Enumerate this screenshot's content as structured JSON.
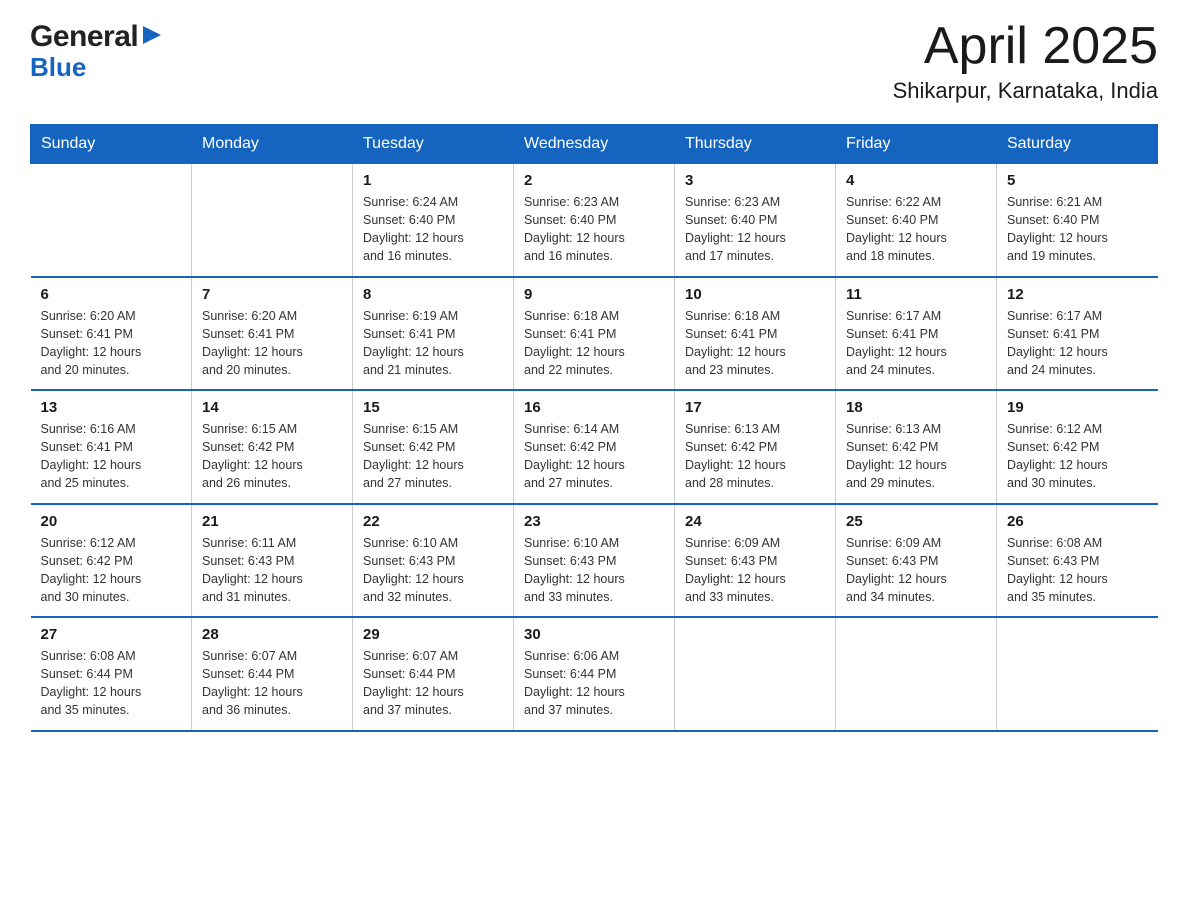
{
  "header": {
    "logo": {
      "general": "General",
      "blue": "Blue",
      "arrow_symbol": "▶"
    },
    "title": "April 2025",
    "location": "Shikarpur, Karnataka, India"
  },
  "calendar": {
    "days_of_week": [
      "Sunday",
      "Monday",
      "Tuesday",
      "Wednesday",
      "Thursday",
      "Friday",
      "Saturday"
    ],
    "weeks": [
      [
        {
          "day": "",
          "info": ""
        },
        {
          "day": "",
          "info": ""
        },
        {
          "day": "1",
          "info": "Sunrise: 6:24 AM\nSunset: 6:40 PM\nDaylight: 12 hours\nand 16 minutes."
        },
        {
          "day": "2",
          "info": "Sunrise: 6:23 AM\nSunset: 6:40 PM\nDaylight: 12 hours\nand 16 minutes."
        },
        {
          "day": "3",
          "info": "Sunrise: 6:23 AM\nSunset: 6:40 PM\nDaylight: 12 hours\nand 17 minutes."
        },
        {
          "day": "4",
          "info": "Sunrise: 6:22 AM\nSunset: 6:40 PM\nDaylight: 12 hours\nand 18 minutes."
        },
        {
          "day": "5",
          "info": "Sunrise: 6:21 AM\nSunset: 6:40 PM\nDaylight: 12 hours\nand 19 minutes."
        }
      ],
      [
        {
          "day": "6",
          "info": "Sunrise: 6:20 AM\nSunset: 6:41 PM\nDaylight: 12 hours\nand 20 minutes."
        },
        {
          "day": "7",
          "info": "Sunrise: 6:20 AM\nSunset: 6:41 PM\nDaylight: 12 hours\nand 20 minutes."
        },
        {
          "day": "8",
          "info": "Sunrise: 6:19 AM\nSunset: 6:41 PM\nDaylight: 12 hours\nand 21 minutes."
        },
        {
          "day": "9",
          "info": "Sunrise: 6:18 AM\nSunset: 6:41 PM\nDaylight: 12 hours\nand 22 minutes."
        },
        {
          "day": "10",
          "info": "Sunrise: 6:18 AM\nSunset: 6:41 PM\nDaylight: 12 hours\nand 23 minutes."
        },
        {
          "day": "11",
          "info": "Sunrise: 6:17 AM\nSunset: 6:41 PM\nDaylight: 12 hours\nand 24 minutes."
        },
        {
          "day": "12",
          "info": "Sunrise: 6:17 AM\nSunset: 6:41 PM\nDaylight: 12 hours\nand 24 minutes."
        }
      ],
      [
        {
          "day": "13",
          "info": "Sunrise: 6:16 AM\nSunset: 6:41 PM\nDaylight: 12 hours\nand 25 minutes."
        },
        {
          "day": "14",
          "info": "Sunrise: 6:15 AM\nSunset: 6:42 PM\nDaylight: 12 hours\nand 26 minutes."
        },
        {
          "day": "15",
          "info": "Sunrise: 6:15 AM\nSunset: 6:42 PM\nDaylight: 12 hours\nand 27 minutes."
        },
        {
          "day": "16",
          "info": "Sunrise: 6:14 AM\nSunset: 6:42 PM\nDaylight: 12 hours\nand 27 minutes."
        },
        {
          "day": "17",
          "info": "Sunrise: 6:13 AM\nSunset: 6:42 PM\nDaylight: 12 hours\nand 28 minutes."
        },
        {
          "day": "18",
          "info": "Sunrise: 6:13 AM\nSunset: 6:42 PM\nDaylight: 12 hours\nand 29 minutes."
        },
        {
          "day": "19",
          "info": "Sunrise: 6:12 AM\nSunset: 6:42 PM\nDaylight: 12 hours\nand 30 minutes."
        }
      ],
      [
        {
          "day": "20",
          "info": "Sunrise: 6:12 AM\nSunset: 6:42 PM\nDaylight: 12 hours\nand 30 minutes."
        },
        {
          "day": "21",
          "info": "Sunrise: 6:11 AM\nSunset: 6:43 PM\nDaylight: 12 hours\nand 31 minutes."
        },
        {
          "day": "22",
          "info": "Sunrise: 6:10 AM\nSunset: 6:43 PM\nDaylight: 12 hours\nand 32 minutes."
        },
        {
          "day": "23",
          "info": "Sunrise: 6:10 AM\nSunset: 6:43 PM\nDaylight: 12 hours\nand 33 minutes."
        },
        {
          "day": "24",
          "info": "Sunrise: 6:09 AM\nSunset: 6:43 PM\nDaylight: 12 hours\nand 33 minutes."
        },
        {
          "day": "25",
          "info": "Sunrise: 6:09 AM\nSunset: 6:43 PM\nDaylight: 12 hours\nand 34 minutes."
        },
        {
          "day": "26",
          "info": "Sunrise: 6:08 AM\nSunset: 6:43 PM\nDaylight: 12 hours\nand 35 minutes."
        }
      ],
      [
        {
          "day": "27",
          "info": "Sunrise: 6:08 AM\nSunset: 6:44 PM\nDaylight: 12 hours\nand 35 minutes."
        },
        {
          "day": "28",
          "info": "Sunrise: 6:07 AM\nSunset: 6:44 PM\nDaylight: 12 hours\nand 36 minutes."
        },
        {
          "day": "29",
          "info": "Sunrise: 6:07 AM\nSunset: 6:44 PM\nDaylight: 12 hours\nand 37 minutes."
        },
        {
          "day": "30",
          "info": "Sunrise: 6:06 AM\nSunset: 6:44 PM\nDaylight: 12 hours\nand 37 minutes."
        },
        {
          "day": "",
          "info": ""
        },
        {
          "day": "",
          "info": ""
        },
        {
          "day": "",
          "info": ""
        }
      ]
    ]
  }
}
